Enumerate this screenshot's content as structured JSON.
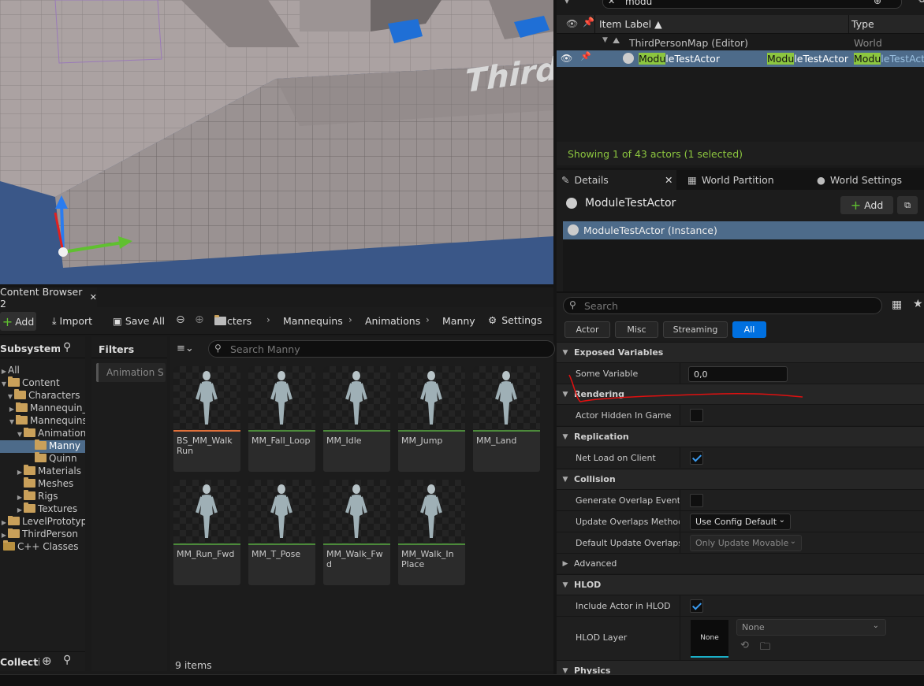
{
  "outliner": {
    "search_value": "modu",
    "col_label": "Item Label ▲",
    "col_type": "Type",
    "rows": [
      {
        "label": "ThirdPersonMap (Editor)",
        "type": "World"
      },
      {
        "label_match": "Modu",
        "label_rest": "leTestActor",
        "type_match": "Modu",
        "type_rest": "leTestActor",
        "type2_match": "Modu",
        "type2_rest": "leTestActo"
      }
    ],
    "status": "Showing 1 of 43 actors (1 selected)"
  },
  "details": {
    "tabs": [
      "Details",
      "World Partition",
      "World Settings"
    ],
    "actor_name": "ModuleTestActor",
    "add_label": "Add",
    "instance_label": "ModuleTestActor (Instance)",
    "search_placeholder": "Search",
    "filters": [
      "Actor",
      "Misc",
      "Streaming",
      "All"
    ],
    "categories": {
      "exposed": "Exposed Variables",
      "rendering": "Rendering",
      "replication": "Replication",
      "collision": "Collision",
      "advanced": "Advanced",
      "hlod": "HLOD",
      "physics": "Physics"
    },
    "props": {
      "some_variable": {
        "label": "Some Variable",
        "value": "0,0"
      },
      "actor_hidden": {
        "label": "Actor Hidden In Game",
        "checked": false
      },
      "net_load": {
        "label": "Net Load on Client",
        "checked": true
      },
      "gen_overlap": {
        "label": "Generate Overlap Events...",
        "checked": false
      },
      "update_overlaps": {
        "label": "Update Overlaps Method...",
        "value": "Use Config Default"
      },
      "default_update": {
        "label": "Default Update Overlaps...",
        "value": "Only Update Movable"
      },
      "include_hlod": {
        "label": "Include Actor in HLOD",
        "checked": true
      },
      "hlod_layer": {
        "label": "HLOD Layer",
        "thumb": "None",
        "value": "None"
      }
    }
  },
  "content_browser": {
    "title": "Content Browser 2",
    "add": "Add",
    "import": "Import",
    "save_all": "Save All",
    "breadcrumb": [
      "cters",
      "Mannequins",
      "Animations",
      "Manny"
    ],
    "settings": "Settings",
    "sources_title": "SubsystemT",
    "filters_title": "Filters",
    "filter_chip": "Animation S",
    "search_placeholder": "Search Manny",
    "tree": [
      {
        "label": "All",
        "depth": 0
      },
      {
        "label": "Content",
        "depth": 1
      },
      {
        "label": "Characters",
        "depth": 2
      },
      {
        "label": "Mannequin_",
        "depth": 3
      },
      {
        "label": "Mannequins",
        "depth": 3
      },
      {
        "label": "Animation",
        "depth": 4
      },
      {
        "label": "Manny",
        "depth": 5
      },
      {
        "label": "Quinn",
        "depth": 5
      },
      {
        "label": "Materials",
        "depth": 4
      },
      {
        "label": "Meshes",
        "depth": 4
      },
      {
        "label": "Rigs",
        "depth": 4
      },
      {
        "label": "Textures",
        "depth": 4
      },
      {
        "label": "LevelPrototyp",
        "depth": 1
      },
      {
        "label": "ThirdPerson",
        "depth": 1
      },
      {
        "label": "C++ Classes",
        "depth": 0
      }
    ],
    "assets": [
      "BS_MM_Walk Run",
      "MM_Fall_Loop",
      "MM_Idle",
      "MM_Jump",
      "MM_Land",
      "MM_Run_Fwd",
      "MM_T_Pose",
      "MM_Walk_Fwd",
      "MM_Walk_In Place"
    ],
    "collections": "Collectic",
    "item_count": "9 items"
  },
  "viewport": {
    "watermark": "Third"
  },
  "colors": {
    "accent": "#0070e0",
    "match": "#8cc63f",
    "annotation": "#e01010"
  }
}
